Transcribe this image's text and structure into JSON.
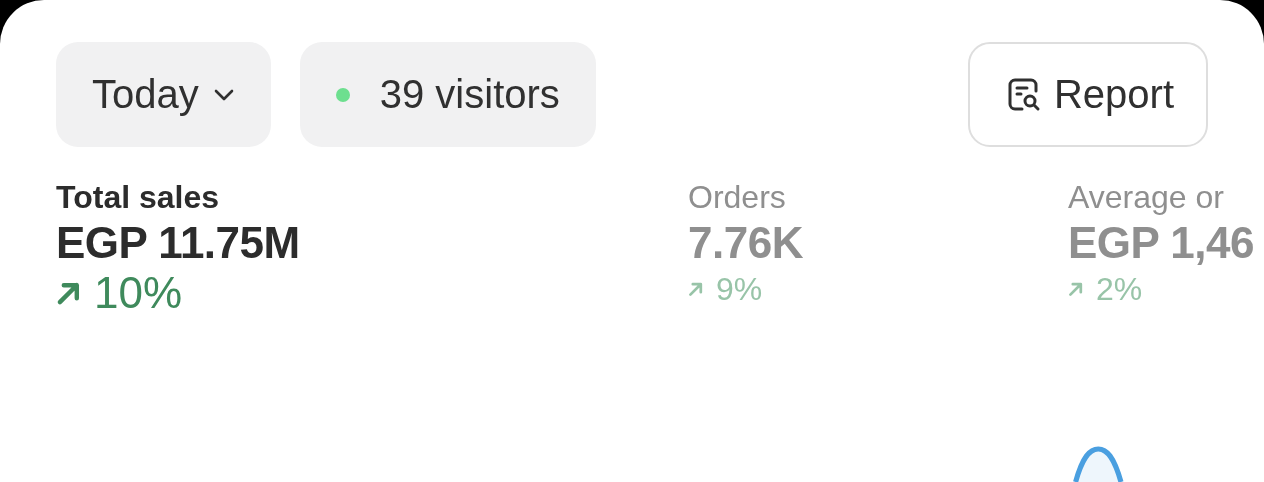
{
  "filters": {
    "period": {
      "label": "Today"
    },
    "visitors": {
      "label": "39 visitors",
      "color": "#6ddf8f"
    }
  },
  "report_button": {
    "label": "Report"
  },
  "metrics": [
    {
      "label": "Total sales",
      "value": "EGP 11.75M",
      "change": "10%",
      "selected": true
    },
    {
      "label": "Orders",
      "value": "7.76K",
      "change": "9%",
      "selected": false
    },
    {
      "label": "Average or",
      "value": "EGP 1,46",
      "change": "2%",
      "selected": false
    }
  ]
}
